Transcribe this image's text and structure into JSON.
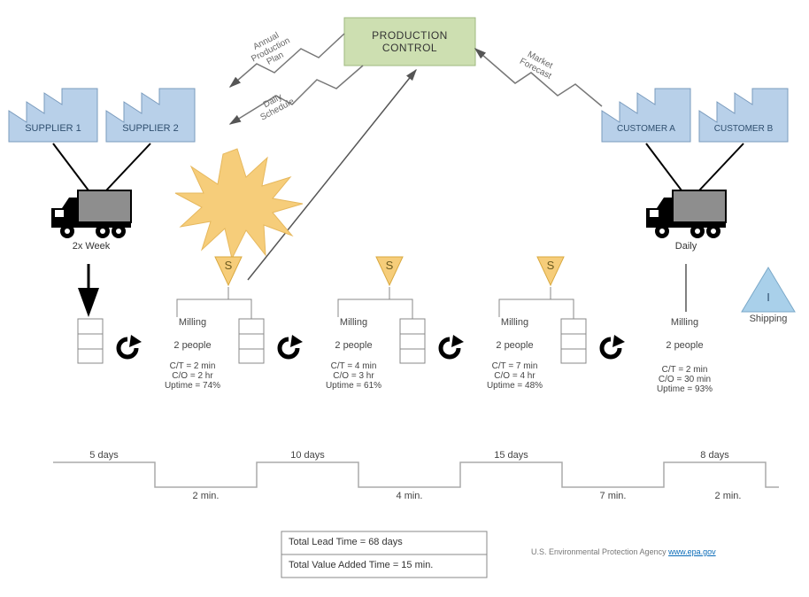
{
  "control": {
    "title": "PRODUCTION\nCONTROL"
  },
  "info_arrows": {
    "annual": "Annual\nProduction\nPlan",
    "daily": "Daily\nSchedule",
    "forecast": "Market\nForecast"
  },
  "suppliers": [
    {
      "name": "SUPPLIER 1"
    },
    {
      "name": "SUPPLIER 2"
    }
  ],
  "customers": [
    {
      "name": "CUSTOMER A"
    },
    {
      "name": "CUSTOMER B"
    }
  ],
  "supply_truck_freq": "2x Week",
  "customer_truck_freq": "Daily",
  "supermarket_label": "S",
  "shipping": {
    "letter": "I",
    "label": "Shipping"
  },
  "processes": [
    {
      "name": "Milling",
      "people": "2 people",
      "ct": "C/T = 2 min",
      "co": "C/O = 2 hr",
      "uptime": "Uptime = 74%"
    },
    {
      "name": "Milling",
      "people": "2 people",
      "ct": "C/T = 4 min",
      "co": "C/O = 3 hr",
      "uptime": "Uptime = 61%"
    },
    {
      "name": "Milling",
      "people": "2 people",
      "ct": "C/T = 7 min",
      "co": "C/O = 4 hr",
      "uptime": "Uptime = 48%"
    },
    {
      "name": "Milling",
      "people": "2 people",
      "ct": "C/T = 2 min",
      "co": "C/O = 30 min",
      "uptime": "Uptime = 93%"
    }
  ],
  "timeline": {
    "wait": [
      "5 days",
      "10 days",
      "15 days",
      "8 days"
    ],
    "value": [
      "2 min.",
      "4 min.",
      "7 min.",
      "2 min."
    ]
  },
  "totals": {
    "lead": "Total Lead Time = 68 days",
    "vat": "Total Value Added Time = 15 min."
  },
  "footer": {
    "agency": "U.S. Environmental Protection Agency ",
    "link_text": "www.epa.gov",
    "link_href": "http://www.epa.gov"
  },
  "chart_data": {
    "type": "table",
    "description": "Value Stream Map",
    "suppliers": [
      "SUPPLIER 1",
      "SUPPLIER 2"
    ],
    "customers": [
      "CUSTOMER A",
      "CUSTOMER B"
    ],
    "supplier_shipment_frequency": "2x Week",
    "customer_shipment_frequency": "Daily",
    "process_steps": [
      {
        "step": 1,
        "name": "Milling",
        "people": 2,
        "cycle_time_min": 2,
        "changeover_hr": 2,
        "uptime_pct": 74
      },
      {
        "step": 2,
        "name": "Milling",
        "people": 2,
        "cycle_time_min": 4,
        "changeover_hr": 3,
        "uptime_pct": 61
      },
      {
        "step": 3,
        "name": "Milling",
        "people": 2,
        "cycle_time_min": 7,
        "changeover_hr": 4,
        "uptime_pct": 48
      },
      {
        "step": 4,
        "name": "Milling",
        "people": 2,
        "cycle_time_min": 2,
        "changeover_hr": 0.5,
        "uptime_pct": 93
      }
    ],
    "inventory_days_before_step": [
      5,
      10,
      15,
      8
    ],
    "total_lead_time_days": 68,
    "total_value_added_time_min": 15
  }
}
